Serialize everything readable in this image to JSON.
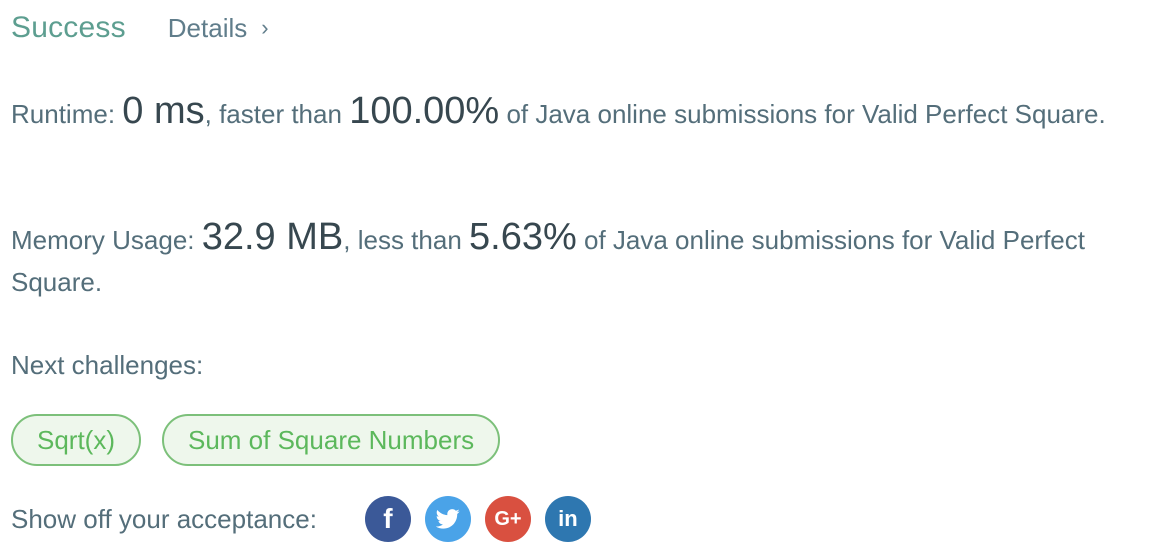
{
  "header": {
    "status": "Success",
    "details_label": "Details",
    "details_chevron": "›"
  },
  "runtime": {
    "label": "Runtime:",
    "value": "0 ms",
    "comparison": ", faster than",
    "percent": "100.00%",
    "suffix": "of Java online submissions for Valid Perfect Square."
  },
  "memory": {
    "label": "Memory Usage:",
    "value": "32.9 MB",
    "comparison": ", less than",
    "percent": "5.63%",
    "suffix": "of Java online submissions for Valid Perfect Square."
  },
  "next": {
    "label": "Next challenges:",
    "challenges": [
      {
        "label": "Sqrt(x)"
      },
      {
        "label": "Sum of Square Numbers"
      }
    ]
  },
  "share": {
    "label": "Show off your acceptance:",
    "icons": [
      {
        "name": "facebook-icon",
        "glyph": "f",
        "color": "#3b5998"
      },
      {
        "name": "twitter-icon",
        "glyph": "",
        "color": "#4aa3e8"
      },
      {
        "name": "google-plus-icon",
        "glyph": "G+",
        "color": "#d95040"
      },
      {
        "name": "linkedin-icon",
        "glyph": "in",
        "color": "#2e77b0"
      }
    ]
  },
  "colors": {
    "success": "#5d9e90",
    "text": "#546e7a",
    "pill_border": "#7cc07a",
    "pill_text": "#5cb85c"
  }
}
